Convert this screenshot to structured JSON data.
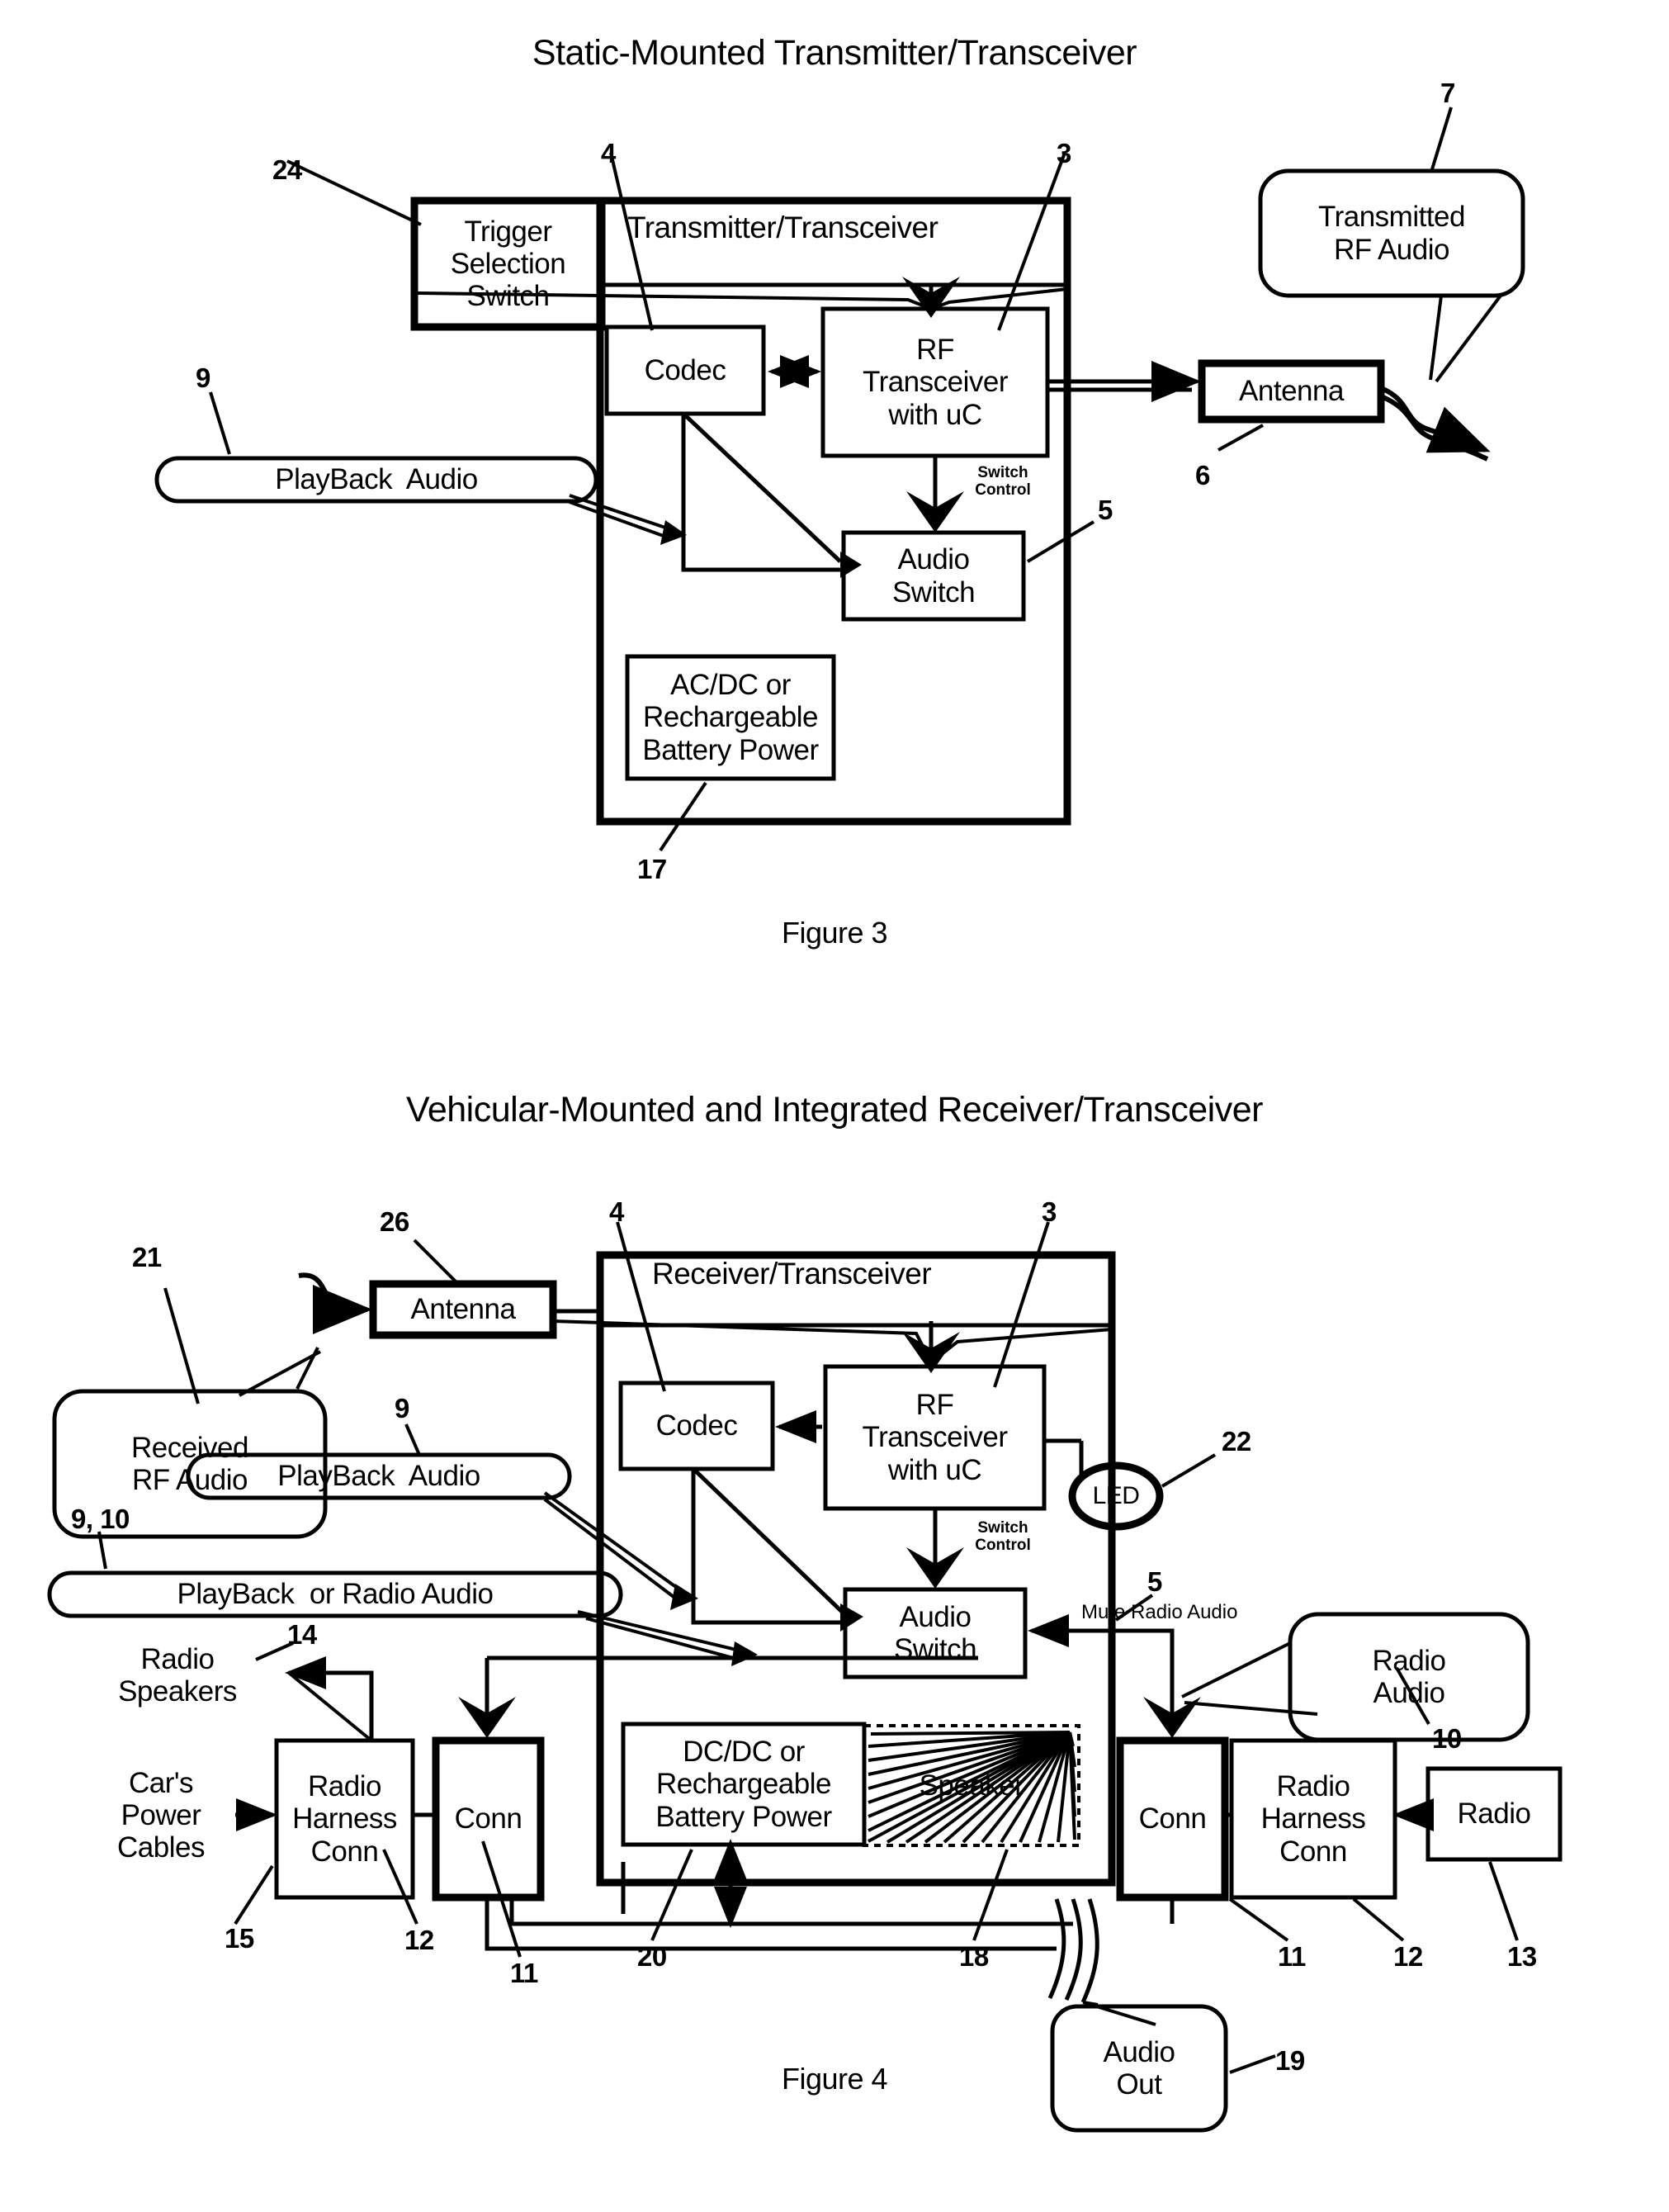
{
  "figure3": {
    "title": "Static-Mounted Transmitter/Transceiver",
    "caption": "Figure 3",
    "boxes": {
      "trigger_selection_switch": "Trigger\nSelection\nSwitch",
      "transmitter_transceiver": "Transmitter/Transceiver",
      "codec": "Codec",
      "rf_transceiver": "RF\nTransceiver\nwith uC",
      "audio_switch": "Audio\nSwitch",
      "power": "AC/DC or\nRechargeable\nBattery Power",
      "antenna": "Antenna"
    },
    "callouts": {
      "transmitted_rf_audio": "Transmitted\nRF Audio",
      "playback_audio": "PlayBack  Audio"
    },
    "edge_labels": {
      "switch_control": "Switch\nControl"
    },
    "ref_numbers": {
      "trigger_switch": "24",
      "transmitter": "4",
      "rf_transceiver": "3",
      "rf_audio": "7",
      "playback_audio": "9",
      "antenna": "6",
      "audio_switch": "5",
      "power": "17"
    }
  },
  "figure4": {
    "title": "Vehicular-Mounted and Integrated Receiver/Transceiver",
    "caption": "Figure 4",
    "boxes": {
      "antenna": "Antenna",
      "receiver_transceiver": "Receiver/Transceiver",
      "codec": "Codec",
      "rf_transceiver": "RF\nTransceiver\nwith uC",
      "audio_switch": "Audio\nSwitch",
      "power": "DC/DC or\nRechargeable\nBattery Power",
      "speaker": "Speaker",
      "led": "LED",
      "radio_harness_conn_left": "Radio\nHarness\nConn",
      "conn_left": "Conn",
      "conn_right": "Conn",
      "radio_harness_conn_right": "Radio\nHarness\nConn",
      "radio": "Radio"
    },
    "callouts": {
      "received_rf_audio": "Received\nRF Audio",
      "playback_audio": "PlayBack  Audio",
      "playback_or_radio_audio": "PlayBack  or Radio Audio",
      "radio_audio": "Radio\nAudio",
      "audio_out": "Audio\nOut"
    },
    "plain_labels": {
      "radio_speakers": "Radio\nSpeakers",
      "cars_power_cables": "Car's\nPower\nCables"
    },
    "edge_labels": {
      "switch_control": "Switch\nControl",
      "mute_radio_audio": "Mute Radio Audio"
    },
    "ref_numbers": {
      "received_rf_audio": "21",
      "antenna": "26",
      "receiver": "4",
      "rf_transceiver": "3",
      "playback_audio": "9",
      "playback_or_radio_audio": "9, 10",
      "led": "22",
      "audio_switch": "5",
      "radio_audio": "10",
      "radio_speakers": "14",
      "cars_power_cables": "15",
      "harness_conn_left": "12",
      "conn_left": "11",
      "power": "20",
      "speaker": "18",
      "conn_right": "11",
      "harness_conn_right": "12",
      "radio": "13",
      "audio_out": "19"
    }
  }
}
